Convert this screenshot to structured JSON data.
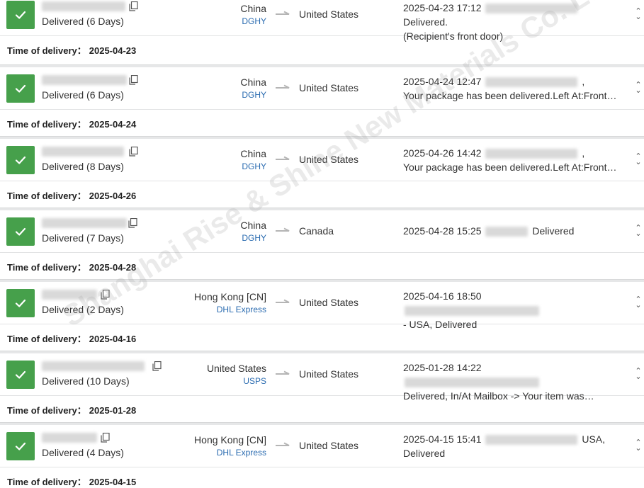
{
  "watermark": "Shanghai Rise & Shine New Materials Co. Ltd",
  "time_label": "Time of delivery：",
  "shipments": [
    {
      "status": "Delivered (6 Days)",
      "origin": "China",
      "carrier": "DGHY",
      "destination": "United States",
      "event_line1": "2025-04-23 17:12",
      "event_line1_tail": "Delivered.",
      "event_line2": "(Recipient's front door)",
      "delivery_date": "2025-04-23"
    },
    {
      "status": "Delivered (6 Days)",
      "origin": "China",
      "carrier": "DGHY",
      "destination": "United States",
      "event_line1": "2025-04-24 12:47",
      "event_line1_tail": ",",
      "event_line2": "Your package has been delivered.Left At:Front…",
      "delivery_date": "2025-04-24"
    },
    {
      "status": "Delivered (8 Days)",
      "origin": "China",
      "carrier": "DGHY",
      "destination": "United States",
      "event_line1": "2025-04-26 14:42",
      "event_line1_tail": ",",
      "event_line2": "Your package has been delivered.Left At:Front…",
      "delivery_date": "2025-04-26"
    },
    {
      "status": "Delivered (7 Days)",
      "origin": "China",
      "carrier": "DGHY",
      "destination": "Canada",
      "event_line1": "2025-04-28 15:25",
      "event_line1_tail": "Delivered",
      "event_line2": "",
      "delivery_date": "2025-04-28"
    },
    {
      "status": "Delivered (2 Days)",
      "origin": "Hong Kong [CN]",
      "carrier": "DHL Express",
      "destination": "United States",
      "event_line1": "2025-04-16 18:50",
      "event_line1_tail": "",
      "event_line2": "- USA, Delivered",
      "delivery_date": "2025-04-16"
    },
    {
      "status": "Delivered (10 Days)",
      "origin": "United States",
      "carrier": "USPS",
      "destination": "United States",
      "event_line1": "2025-01-28 14:22",
      "event_line1_tail": "",
      "event_line2": "Delivered, In/At Mailbox -> Your item was…",
      "delivery_date": "2025-01-28"
    },
    {
      "status": "Delivered (4 Days)",
      "origin": "Hong Kong [CN]",
      "carrier": "DHL Express",
      "destination": "United States",
      "event_line1": "2025-04-15 15:41",
      "event_line1_tail": "USA,",
      "event_line2": "Delivered",
      "delivery_date": "2025-04-15"
    }
  ],
  "icons": {
    "status": "check-icon",
    "copy": "copy-icon",
    "route": "arrow-right-icon",
    "expand": "chevron-up-down-icon"
  },
  "colors": {
    "delivered_green": "#46a04b",
    "carrier_blue": "#2a6bb0"
  }
}
